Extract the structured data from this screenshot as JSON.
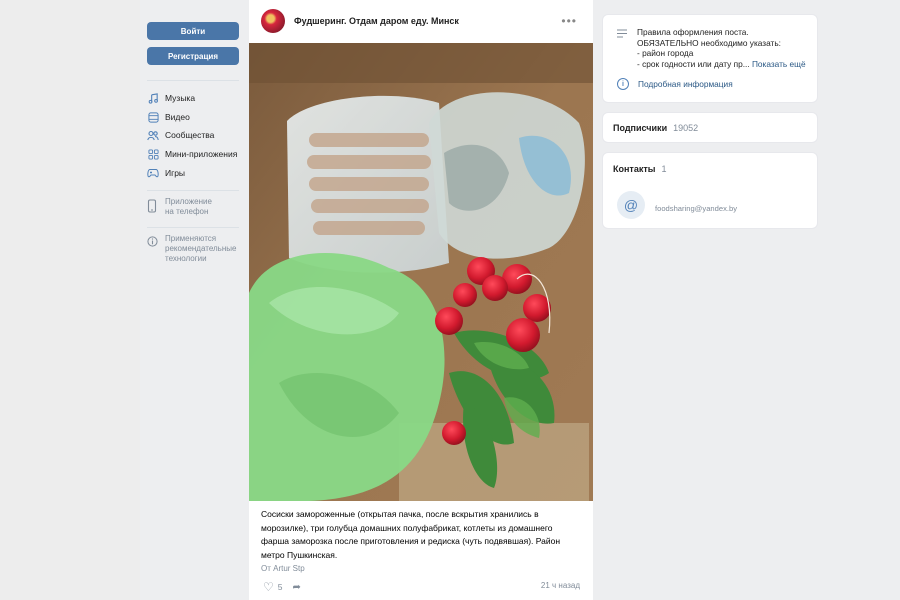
{
  "colors": {
    "accent": "#4a76a8",
    "link": "#2a5885",
    "muted": "#818c99",
    "background": "#edeef0"
  },
  "auth": {
    "login_label": "Войти",
    "register_label": "Регистрация"
  },
  "sidebar": {
    "items": [
      {
        "label": "Музыка",
        "icon": "music-icon"
      },
      {
        "label": "Видео",
        "icon": "video-icon"
      },
      {
        "label": "Сообщества",
        "icon": "communities-icon"
      },
      {
        "label": "Мини-приложения",
        "icon": "mini-apps-icon"
      },
      {
        "label": "Игры",
        "icon": "games-icon"
      }
    ],
    "app_label": "Приложение\nна телефон",
    "recommend_label": "Применяются\nрекомендательные\nтехнологии"
  },
  "post": {
    "group_name": "Фудшеринг. Отдам даром еду. Минск",
    "text": "Сосиски замороженные (открытая пачка, после вскрытия хранились в морозилке), три голубца домашних полуфабрикат, котлеты из домашнего фарша заморозка после приготовления и редиска (чуть подвявшая). Район метро Пушкинская.",
    "author": "От Artur Stp",
    "likes": "5",
    "time": "21 ч назад"
  },
  "right": {
    "info_text": "Правила оформления поста.\nОБЯЗАТЕЛЬНО необходимо указать:\n- район города\n- срок годности или дату пр...",
    "show_more": "Показать ещё",
    "detail_link": "Подробная информация",
    "subscribers_label": "Подписчики",
    "subscribers_count": "19052",
    "contacts_label": "Контакты",
    "contacts_count": "1",
    "email": "foodsharing@yandex.by"
  }
}
